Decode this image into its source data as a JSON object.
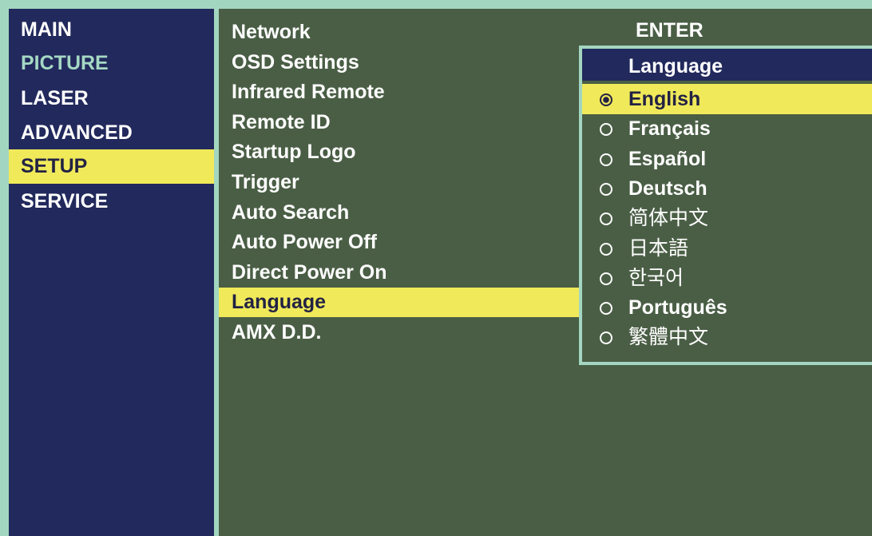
{
  "categories": [
    {
      "label": "MAIN",
      "state": "normal"
    },
    {
      "label": "PICTURE",
      "state": "accent"
    },
    {
      "label": "LASER",
      "state": "normal"
    },
    {
      "label": "ADVANCED",
      "state": "normal"
    },
    {
      "label": "SETUP",
      "state": "selected"
    },
    {
      "label": "SERVICE",
      "state": "normal"
    }
  ],
  "setup_items": [
    {
      "label": "Network",
      "selected": false
    },
    {
      "label": "OSD Settings",
      "selected": false
    },
    {
      "label": "Infrared Remote",
      "selected": false
    },
    {
      "label": "Remote ID",
      "selected": false
    },
    {
      "label": "Startup Logo",
      "selected": false
    },
    {
      "label": "Trigger",
      "selected": false
    },
    {
      "label": "Auto Search",
      "selected": false
    },
    {
      "label": "Auto Power Off",
      "selected": false
    },
    {
      "label": "Direct Power On",
      "selected": false
    },
    {
      "label": "Language",
      "selected": true
    },
    {
      "label": "AMX D.D.",
      "selected": false
    }
  ],
  "hint": {
    "enter_label": "ENTER"
  },
  "language_menu": {
    "title": "Language",
    "options": [
      {
        "label": "English",
        "selected": true,
        "cjk": false
      },
      {
        "label": "Français",
        "selected": false,
        "cjk": false
      },
      {
        "label": "Español",
        "selected": false,
        "cjk": false
      },
      {
        "label": "Deutsch",
        "selected": false,
        "cjk": false
      },
      {
        "label": "简体中文",
        "selected": false,
        "cjk": true
      },
      {
        "label": "日本語",
        "selected": false,
        "cjk": true
      },
      {
        "label": "한국어",
        "selected": false,
        "cjk": true
      },
      {
        "label": "Português",
        "selected": false,
        "cjk": false
      },
      {
        "label": "繁體中文",
        "selected": false,
        "cjk": true
      }
    ]
  },
  "colors": {
    "navy": "#22295c",
    "green": "#4a5e45",
    "highlight": "#f0e95a",
    "border": "#a3d6c0",
    "accent_text": "#a5d8c4"
  }
}
